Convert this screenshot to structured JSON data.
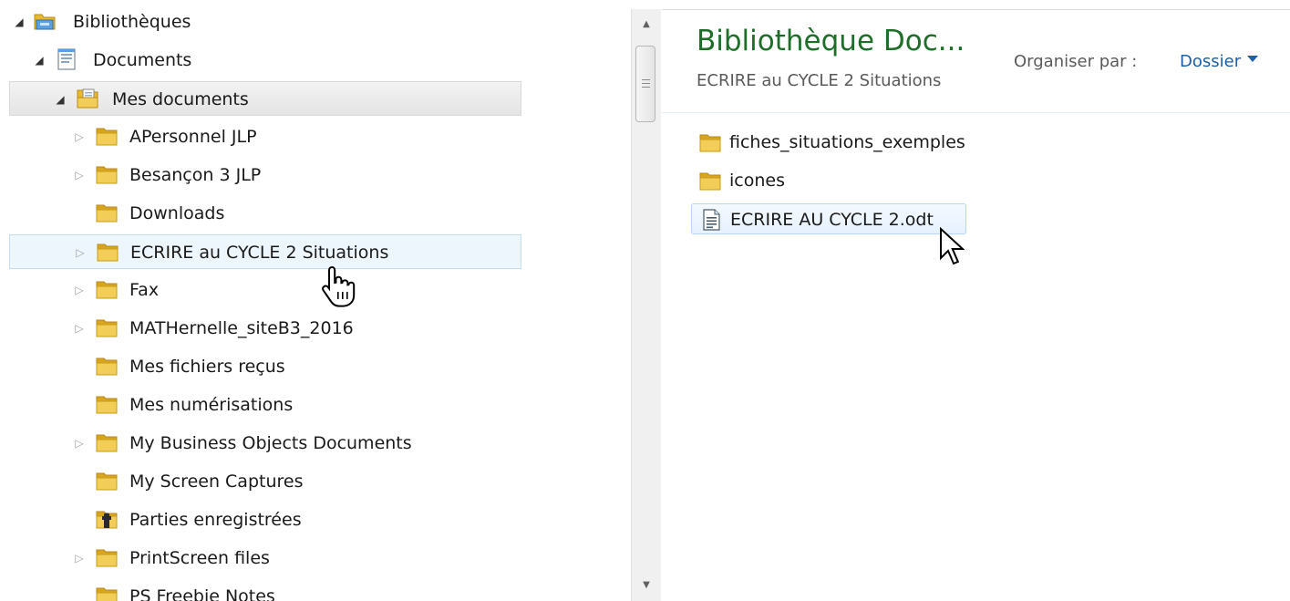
{
  "tree": {
    "items": [
      {
        "label": "Bibliothèques",
        "expander": "◢",
        "icon": "library-icon"
      },
      {
        "label": "Documents",
        "expander": "◢",
        "icon": "document-library-icon"
      },
      {
        "label": "Mes documents",
        "expander": "◢",
        "icon": "documents-folder-icon"
      },
      {
        "label": "APersonnel JLP",
        "expander": "▷",
        "icon": "folder-icon"
      },
      {
        "label": "Besançon 3 JLP",
        "expander": "▷",
        "icon": "folder-icon"
      },
      {
        "label": "Downloads",
        "expander": "",
        "icon": "folder-icon"
      },
      {
        "label": "ECRIRE au CYCLE 2 Situations",
        "expander": "▷",
        "icon": "folder-icon"
      },
      {
        "label": "Fax",
        "expander": "▷",
        "icon": "folder-icon"
      },
      {
        "label": "MATHernelle_siteB3_2016",
        "expander": "▷",
        "icon": "folder-icon"
      },
      {
        "label": "Mes fichiers reçus",
        "expander": "",
        "icon": "folder-icon"
      },
      {
        "label": "Mes numérisations",
        "expander": "",
        "icon": "folder-icon"
      },
      {
        "label": "My Business Objects Documents",
        "expander": "▷",
        "icon": "folder-icon"
      },
      {
        "label": "My Screen Captures",
        "expander": "",
        "icon": "folder-icon"
      },
      {
        "label": "Parties enregistrées",
        "expander": "",
        "icon": "saved-games-icon"
      },
      {
        "label": "PrintScreen files",
        "expander": "▷",
        "icon": "folder-icon"
      },
      {
        "label": "PS Freebie Notes",
        "expander": "",
        "icon": "folder-icon"
      }
    ]
  },
  "scrollbar": {
    "up": "▲",
    "down": "▼"
  },
  "pane": {
    "title": "Bibliothèque Doc...",
    "subtitle": "ECRIRE au CYCLE 2 Situations",
    "arrange_label": "Organiser par :",
    "arrange_value": "Dossier"
  },
  "files": [
    {
      "label": "fiches_situations_exemples",
      "icon": "folder-icon"
    },
    {
      "label": "icones",
      "icon": "folder-icon"
    },
    {
      "label": "ECRIRE AU CYCLE 2.odt",
      "icon": "odt-document-icon"
    }
  ],
  "colors": {
    "title_green": "#1e6e2a",
    "link_blue": "#1e5fa8",
    "folder_yellow": "#e8b930"
  }
}
